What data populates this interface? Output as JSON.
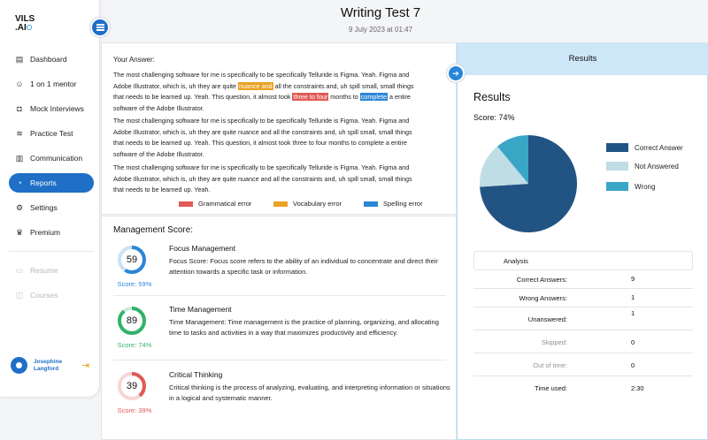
{
  "logo": {
    "line1": "VILS",
    "line2": ".AI"
  },
  "sidebar": {
    "items": [
      {
        "label": "Dashboard",
        "icon": "clipboard-icon"
      },
      {
        "label": "1 on 1 mentor",
        "icon": "mentor-icon"
      },
      {
        "label": "Mock Interviews",
        "icon": "robot-icon"
      },
      {
        "label": "Practice Test",
        "icon": "practice-icon"
      },
      {
        "label": "Communication",
        "icon": "book-icon"
      },
      {
        "label": "Reports",
        "icon": "reports-icon",
        "active": true
      },
      {
        "label": "Settings",
        "icon": "gear-icon"
      },
      {
        "label": "Premium",
        "icon": "crown-icon"
      }
    ],
    "disabled_items": [
      {
        "label": "Resume",
        "icon": "resume-icon"
      },
      {
        "label": "Courses",
        "icon": "courses-icon"
      }
    ],
    "user": {
      "name": "Josephine Langford"
    }
  },
  "header": {
    "title": "Writing Test 7",
    "date": "9 July 2023 at 01:47"
  },
  "answer": {
    "label": "Your Answer:",
    "p1": {
      "a": "The most challenging software for me is specifically to be specifically Telluride is Figma. Yeah. Figma and Adobe Illustrator, which is, uh  they are quite ",
      "vocab": "nuance and",
      "b": " all the constraints and, uh spill small, small things that needs to be learned up. Yeah. This question, it almost took ",
      "gram": "three to four",
      "c": " months to ",
      "spell": "complete",
      "d": " a entire software of the Adobe Illustrator."
    },
    "p2": "The most challenging software for me is specifically to be specifically Telluride is Figma. Yeah. Figma and Adobe Illustrator, which is, uh  they are quite nuance and all the constraints and, uh spill small, small things that needs to be learned up. Yeah. This question, it almost took three to four months to complete a entire software of the Adobe Illustrator.",
    "p3": "The most challenging software for me is specifically to be specifically Telluride is Figma. Yeah. Figma and Adobe Illustrator, which is, uh  they are quite nuance and all the constraints and, uh spill small, small things that needs to be learned up. Yeah.",
    "legend": {
      "grammatical": "Grammatical error",
      "vocabulary": "Vocabulary error",
      "spelling": "Spelling error"
    },
    "colors": {
      "grammatical": "#e05a55",
      "vocabulary": "#e9a222",
      "spelling": "#2a86d6"
    }
  },
  "management": {
    "title": "Management Score:",
    "skills": [
      {
        "value": "59",
        "fraction": 0.59,
        "score": "Score: 59%",
        "color": "#2a86d6",
        "name": "Focus Management",
        "desc": "Focus Score: Focus score refers to the ability of an individual to concentrate and direct their attention towards a specific task or information."
      },
      {
        "value": "89",
        "fraction": 0.89,
        "score": "Score: 74%",
        "color": "#2fb36a",
        "name": "Time Management",
        "desc": "Time Management: Time management is the practice of planning, organizing, and allocating time to tasks and activities in a way that maximizes productivity and efficiency."
      },
      {
        "value": "39",
        "fraction": 0.39,
        "score": "Score: 39%",
        "color": "#e05a55",
        "name": "Critical Thinking",
        "desc": "Critical thinking is the process of analyzing, evaluating, and interpreting information or situations in a logical and systematic manner."
      }
    ]
  },
  "results": {
    "tab": "Results",
    "heading": "Results",
    "score": "Score: 74%",
    "legend": {
      "correct": "Correct Answer",
      "not_answered": "Not Answered",
      "wrong": "Wrong"
    },
    "colors": {
      "correct": "#225483",
      "not_answered": "#bfdde4",
      "wrong": "#3aa6c6"
    },
    "analysis": {
      "header": "Analysis",
      "rows": [
        {
          "k": "Correct Answers:",
          "v": "9"
        },
        {
          "k": "Wrong Answers:",
          "v": "1"
        },
        {
          "k": "Unanswered:",
          "v": "1"
        },
        {
          "k": "Skipped:",
          "v": "0"
        },
        {
          "k": "Out of time:",
          "v": "0"
        },
        {
          "k": "Time used:",
          "v": "2:30"
        }
      ]
    }
  },
  "chart_data": {
    "type": "pie",
    "labels": [
      "Correct Answer",
      "Not Answered",
      "Wrong"
    ],
    "values": [
      74,
      15,
      11
    ],
    "legend": "right"
  }
}
